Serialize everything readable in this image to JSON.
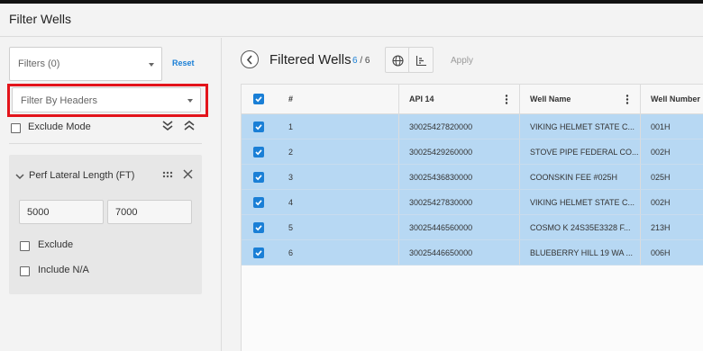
{
  "header": {
    "title": "Filter Wells"
  },
  "left": {
    "filters_select": "Filters (0)",
    "reset_label": "Reset",
    "headers_select_placeholder": "Filter By Headers",
    "exclude_mode_label": "Exclude Mode",
    "filter_card": {
      "title": "Perf Lateral Length (FT)",
      "min_value": "5000",
      "max_value": "7000",
      "exclude_label": "Exclude",
      "include_na_label": "Include N/A"
    }
  },
  "main": {
    "title": "Filtered Wells",
    "count_selected": "6",
    "count_total": "6",
    "count_sep": "/",
    "apply_label": "Apply",
    "table": {
      "columns": [
        "#",
        "API 14",
        "Well Name",
        "Well Number"
      ],
      "rows": [
        {
          "num": "1",
          "api": "30025427820000",
          "name": "VIKING HELMET STATE C...",
          "well_number": "001H"
        },
        {
          "num": "2",
          "api": "30025429260000",
          "name": "STOVE PIPE FEDERAL CO...",
          "well_number": "002H"
        },
        {
          "num": "3",
          "api": "30025436830000",
          "name": "COONSKIN FEE #025H",
          "well_number": "025H"
        },
        {
          "num": "4",
          "api": "30025427830000",
          "name": "VIKING HELMET STATE C...",
          "well_number": "002H"
        },
        {
          "num": "5",
          "api": "30025446560000",
          "name": "COSMO K 24S35E3328 F...",
          "well_number": "213H"
        },
        {
          "num": "6",
          "api": "30025446650000",
          "name": "BLUEBERRY HILL 19 WA ...",
          "well_number": "006H"
        }
      ]
    }
  },
  "colors": {
    "accent": "#1a7fd6",
    "selected_row": "#b7d8f3",
    "highlight_box": "#e3141b"
  }
}
